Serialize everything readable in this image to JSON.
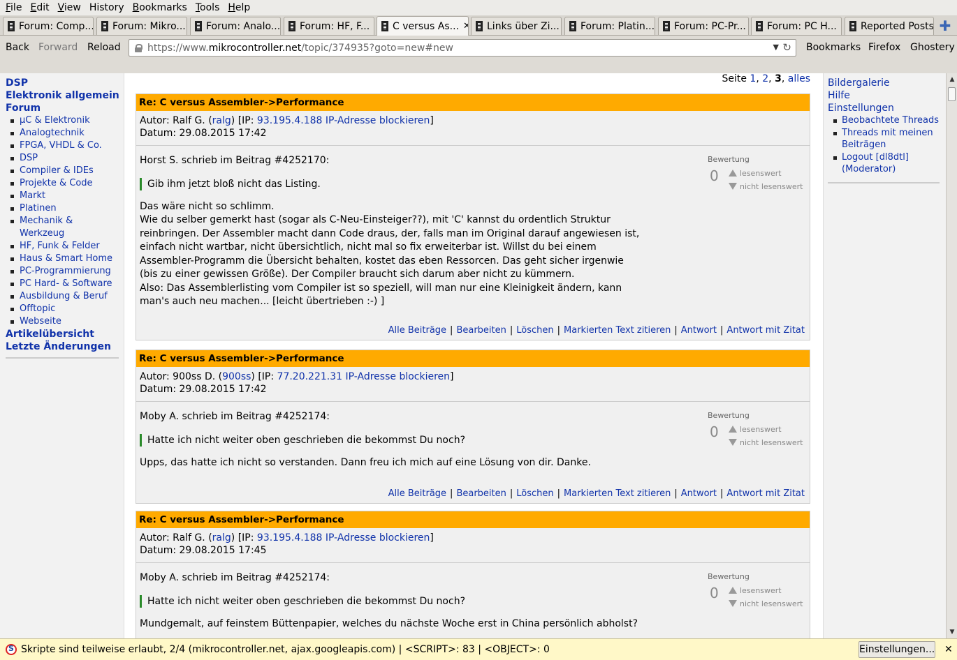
{
  "menubar": {
    "items": [
      {
        "label": "File",
        "accel": "F",
        "rest": "ile"
      },
      {
        "label": "Edit",
        "accel": "E",
        "rest": "dit"
      },
      {
        "label": "View",
        "accel": "V",
        "rest": "iew"
      },
      {
        "label": "History",
        "accel": "H",
        "rest": "istory"
      },
      {
        "label": "Bookmarks",
        "accel": "B",
        "rest": "ookmarks"
      },
      {
        "label": "Tools",
        "accel": "T",
        "rest": "ools"
      },
      {
        "label": "Help",
        "accel": "H",
        "rest": "elp"
      }
    ]
  },
  "tabs": [
    {
      "label": "Forum: Comp..."
    },
    {
      "label": "Forum: Mikro..."
    },
    {
      "label": "Forum: Analo..."
    },
    {
      "label": "Forum: HF, F..."
    },
    {
      "label": "C versus As...",
      "active": true
    },
    {
      "label": "Links über Zi..."
    },
    {
      "label": "Forum: Platin..."
    },
    {
      "label": "Forum: PC-Pr..."
    },
    {
      "label": "Forum: PC H..."
    },
    {
      "label": "Reported Posts"
    }
  ],
  "navbar": {
    "back": "Back",
    "forward": "Forward",
    "reload": "Reload",
    "url_prefix": "https://www.",
    "url_domain": "mikrocontroller.net",
    "url_suffix": "/topic/374935?goto=new#new",
    "bookmarks": "Bookmarks",
    "firefox": "Firefox",
    "ghostery": "Ghostery"
  },
  "leftnav": {
    "top_cut": "DSP",
    "elektronik": "Elektronik allgemein",
    "forum": "Forum",
    "forum_items": [
      "µC & Elektronik",
      "Analogtechnik",
      "FPGA, VHDL & Co.",
      "DSP",
      "Compiler & IDEs",
      "Projekte & Code",
      "Markt",
      "Platinen",
      "Mechanik & Werkzeug",
      "HF, Funk & Felder",
      "Haus & Smart Home",
      "PC-Programmierung",
      "PC Hard- & Software",
      "Ausbildung & Beruf",
      "Offtopic",
      "Webseite"
    ],
    "artikel": "Artikelübersicht",
    "letzte": "Letzte Änderungen"
  },
  "pager": {
    "label": "Seite",
    "p1": "1",
    "p2": "2",
    "p3": "3",
    "all": "alles"
  },
  "posts": [
    {
      "title": "Re: C versus Assembler->Performance",
      "author_prefix": "Autor: Ralf G. (",
      "author_user": "ralg",
      "ip_prefix": ") [IP: ",
      "ip": "93.195.4.188",
      "block": "IP-Adresse blockieren",
      "ip_suffix": "]",
      "date": "Datum: 29.08.2015 17:42",
      "quote_intro": "Horst S. schrieb im Beitrag #4252170:",
      "quote": "Gib ihm jetzt bloß nicht das Listing.",
      "lines": [
        "Das wäre nicht so schlimm.",
        "Wie du selber gemerkt hast (sogar als C-Neu-Einsteiger??), mit 'C' kannst du ordentlich Struktur",
        "reinbringen. Der Assembler macht dann Code draus, der, falls man im Original darauf angewiesen ist,",
        "einfach nicht wartbar, nicht übersichtlich, nicht mal so fix erweiterbar ist. Willst du bei einem",
        "Assembler-Programm die Übersicht behalten, kostet das eben Ressorcen. Das geht sicher irgenwie",
        "(bis zu einer gewissen Größe). Der Compiler braucht sich darum aber nicht zu kümmern.",
        "Also: Das Assemblerlisting vom Compiler ist so speziell, will man nur eine Kleinigkeit ändern, kann",
        "man's auch neu machen... [leicht übertrieben :-) ]"
      ],
      "rating": {
        "label": "Bewertung",
        "score": "0",
        "up": "lesenswert",
        "down": "nicht lesenswert"
      }
    },
    {
      "title": "Re: C versus Assembler->Performance",
      "author_prefix": "Autor: 900ss D. (",
      "author_user": "900ss",
      "ip_prefix": ") [IP: ",
      "ip": "77.20.221.31",
      "block": "IP-Adresse blockieren",
      "ip_suffix": "]",
      "date": "Datum: 29.08.2015 17:42",
      "quote_intro": "Moby A. schrieb im Beitrag #4252174:",
      "quote": "Hatte ich nicht weiter oben geschrieben die bekommst Du noch?",
      "lines": [
        "Upps, das hatte ich nicht so verstanden. Dann freu ich mich auf eine Lösung von dir. Danke."
      ],
      "rating": {
        "label": "Bewertung",
        "score": "0",
        "up": "lesenswert",
        "down": "nicht lesenswert"
      }
    },
    {
      "title": "Re: C versus Assembler->Performance",
      "author_prefix": "Autor: Ralf G. (",
      "author_user": "ralg",
      "ip_prefix": ") [IP: ",
      "ip": "93.195.4.188",
      "block": "IP-Adresse blockieren",
      "ip_suffix": "]",
      "date": "Datum: 29.08.2015 17:45",
      "quote_intro": "Moby A. schrieb im Beitrag #4252174:",
      "quote": "Hatte ich nicht weiter oben geschrieben die bekommst Du noch?",
      "lines": [
        "Mundgemalt, auf feinstem Büttenpapier, welches du nächste Woche erst in China persönlich abholst?"
      ],
      "rating": {
        "label": "Bewertung",
        "score": "0",
        "up": "lesenswert",
        "down": "nicht lesenswert"
      }
    }
  ],
  "post_actions": {
    "all": "Alle Beiträge",
    "edit": "Bearbeiten",
    "delete": "Löschen",
    "quote_marked": "Markierten Text zitieren",
    "reply": "Antwort",
    "reply_quote": "Antwort mit Zitat",
    "sep": "|"
  },
  "rightnav": {
    "gallery": "Bildergalerie",
    "help": "Hilfe",
    "settings": "Einstellungen",
    "sub": [
      "Beobachtete Threads",
      "Threads mit meinen Beiträgen",
      "Logout [dl8dtl] (Moderator)"
    ]
  },
  "noscript": {
    "text": "Skripte sind teilweise erlaubt, 2/4 (mikrocontroller.net, ajax.googleapis.com) | <SCRIPT>: 83 | <OBJECT>: 0",
    "button": "Einstellungen...",
    "close": "✕"
  },
  "colors": {
    "post_header": "#ffaa00",
    "link": "#1133aa",
    "quote_border": "#2a8a2a"
  }
}
